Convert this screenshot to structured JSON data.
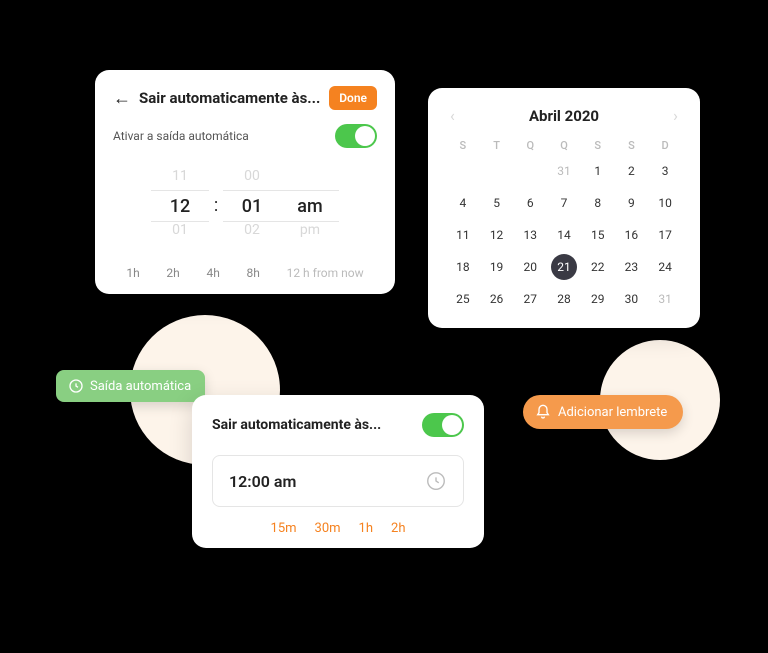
{
  "colors": {
    "accent_orange": "#f58220",
    "accent_green": "#4cc74c"
  },
  "card1": {
    "title": "Sair automaticamente às...",
    "done_label": "Done",
    "subtitle": "Ativar a saída automática",
    "toggle_on": true,
    "picker": {
      "hour_prev": "11",
      "hour": "12",
      "hour_next": "01",
      "min_prev": "00",
      "min": "01",
      "min_next": "02",
      "ampm_prev": "",
      "ampm": "am",
      "ampm_next": "pm",
      "colon": ":"
    },
    "shortcuts": [
      "1h",
      "2h",
      "4h",
      "8h"
    ],
    "shortcut_note": "12 h from now"
  },
  "tag_green": {
    "label": "Saída automática",
    "icon": "clock-icon"
  },
  "card2": {
    "title": "Sair automaticamente às...",
    "toggle_on": true,
    "time_value": "12:00 am",
    "shortcuts": [
      "15m",
      "30m",
      "1h",
      "2h"
    ]
  },
  "calendar": {
    "title": "Abril 2020",
    "dow": [
      "S",
      "T",
      "Q",
      "Q",
      "S",
      "S",
      "D"
    ],
    "weeks": [
      [
        {
          "d": "",
          "t": "e"
        },
        {
          "d": "",
          "t": "e"
        },
        {
          "d": "",
          "t": "e"
        },
        {
          "d": "31",
          "t": "m"
        },
        {
          "d": "1",
          "t": "n"
        },
        {
          "d": "2",
          "t": "n"
        },
        {
          "d": "3",
          "t": "n"
        }
      ],
      [
        {
          "d": "4",
          "t": "n"
        },
        {
          "d": "5",
          "t": "n"
        },
        {
          "d": "6",
          "t": "n"
        },
        {
          "d": "7",
          "t": "n"
        },
        {
          "d": "8",
          "t": "n"
        },
        {
          "d": "9",
          "t": "n"
        },
        {
          "d": "10",
          "t": "n"
        }
      ],
      [
        {
          "d": "11",
          "t": "n"
        },
        {
          "d": "12",
          "t": "n"
        },
        {
          "d": "13",
          "t": "n"
        },
        {
          "d": "14",
          "t": "n"
        },
        {
          "d": "15",
          "t": "n"
        },
        {
          "d": "16",
          "t": "n"
        },
        {
          "d": "17",
          "t": "n"
        }
      ],
      [
        {
          "d": "18",
          "t": "n"
        },
        {
          "d": "19",
          "t": "n"
        },
        {
          "d": "20",
          "t": "n"
        },
        {
          "d": "21",
          "t": "s"
        },
        {
          "d": "22",
          "t": "n"
        },
        {
          "d": "23",
          "t": "n"
        },
        {
          "d": "24",
          "t": "n"
        }
      ],
      [
        {
          "d": "25",
          "t": "n"
        },
        {
          "d": "26",
          "t": "n"
        },
        {
          "d": "27",
          "t": "n"
        },
        {
          "d": "28",
          "t": "n"
        },
        {
          "d": "29",
          "t": "n"
        },
        {
          "d": "30",
          "t": "n"
        },
        {
          "d": "31",
          "t": "m"
        }
      ]
    ]
  },
  "pill_orange": {
    "label": "Adicionar lembrete",
    "icon": "bell-icon"
  }
}
